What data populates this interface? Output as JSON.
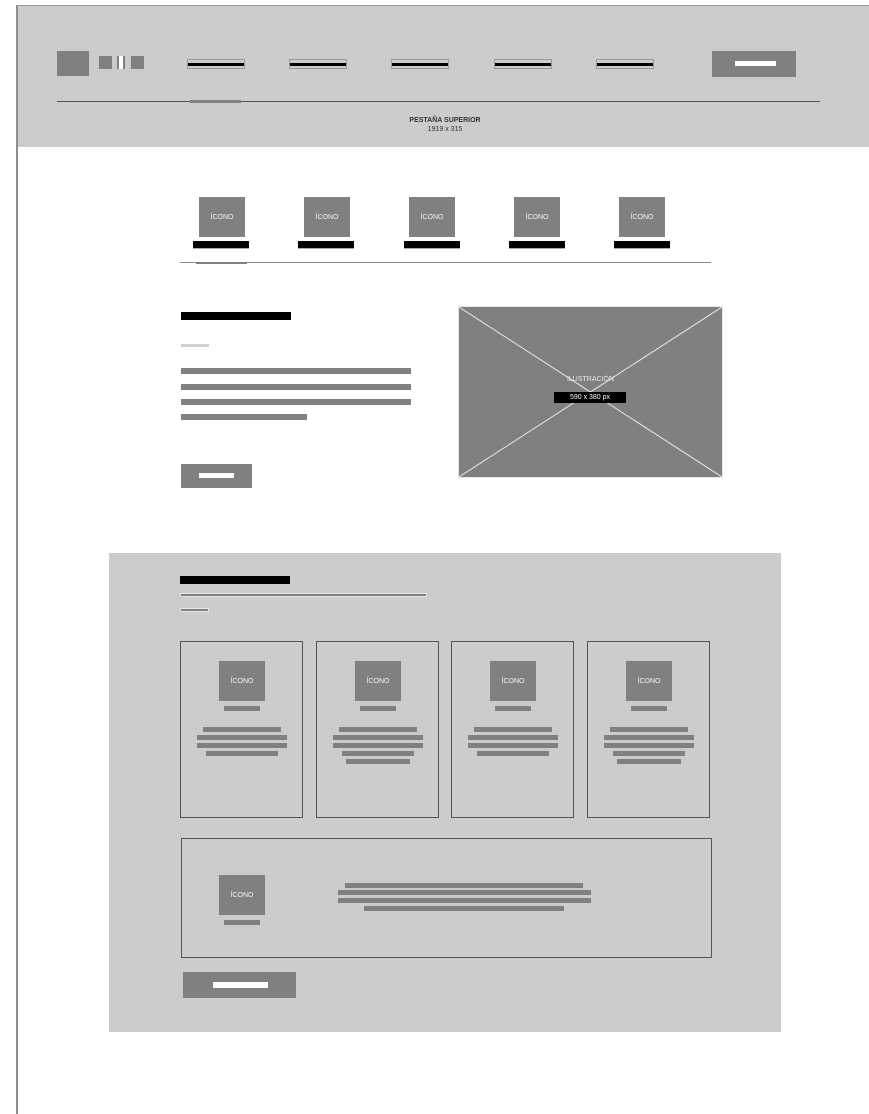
{
  "header": {
    "caption_title": "PESTAÑA SUPERIOR",
    "caption_size": "1919 x 315"
  },
  "icon_tabs": [
    {
      "icon": "ÍCONO"
    },
    {
      "icon": "ÍCONO"
    },
    {
      "icon": "ÍCONO"
    },
    {
      "icon": "ÍCONO"
    },
    {
      "icon": "ÍCONO"
    }
  ],
  "hero": {
    "illustration_label": "ILUSTRACIÓN",
    "illustration_size": "590 x 380 px"
  },
  "features": {
    "cards": [
      {
        "icon": "ÍCONO"
      },
      {
        "icon": "ÍCONO"
      },
      {
        "icon": "ÍCONO"
      },
      {
        "icon": "ÍCONO"
      }
    ],
    "wide_card": {
      "icon": "ÍCONO"
    }
  },
  "colors": {
    "header_bg": "#cccccc",
    "placeholder": "#808080",
    "section_bg": "#cccccc",
    "text_bar": "#000000"
  }
}
